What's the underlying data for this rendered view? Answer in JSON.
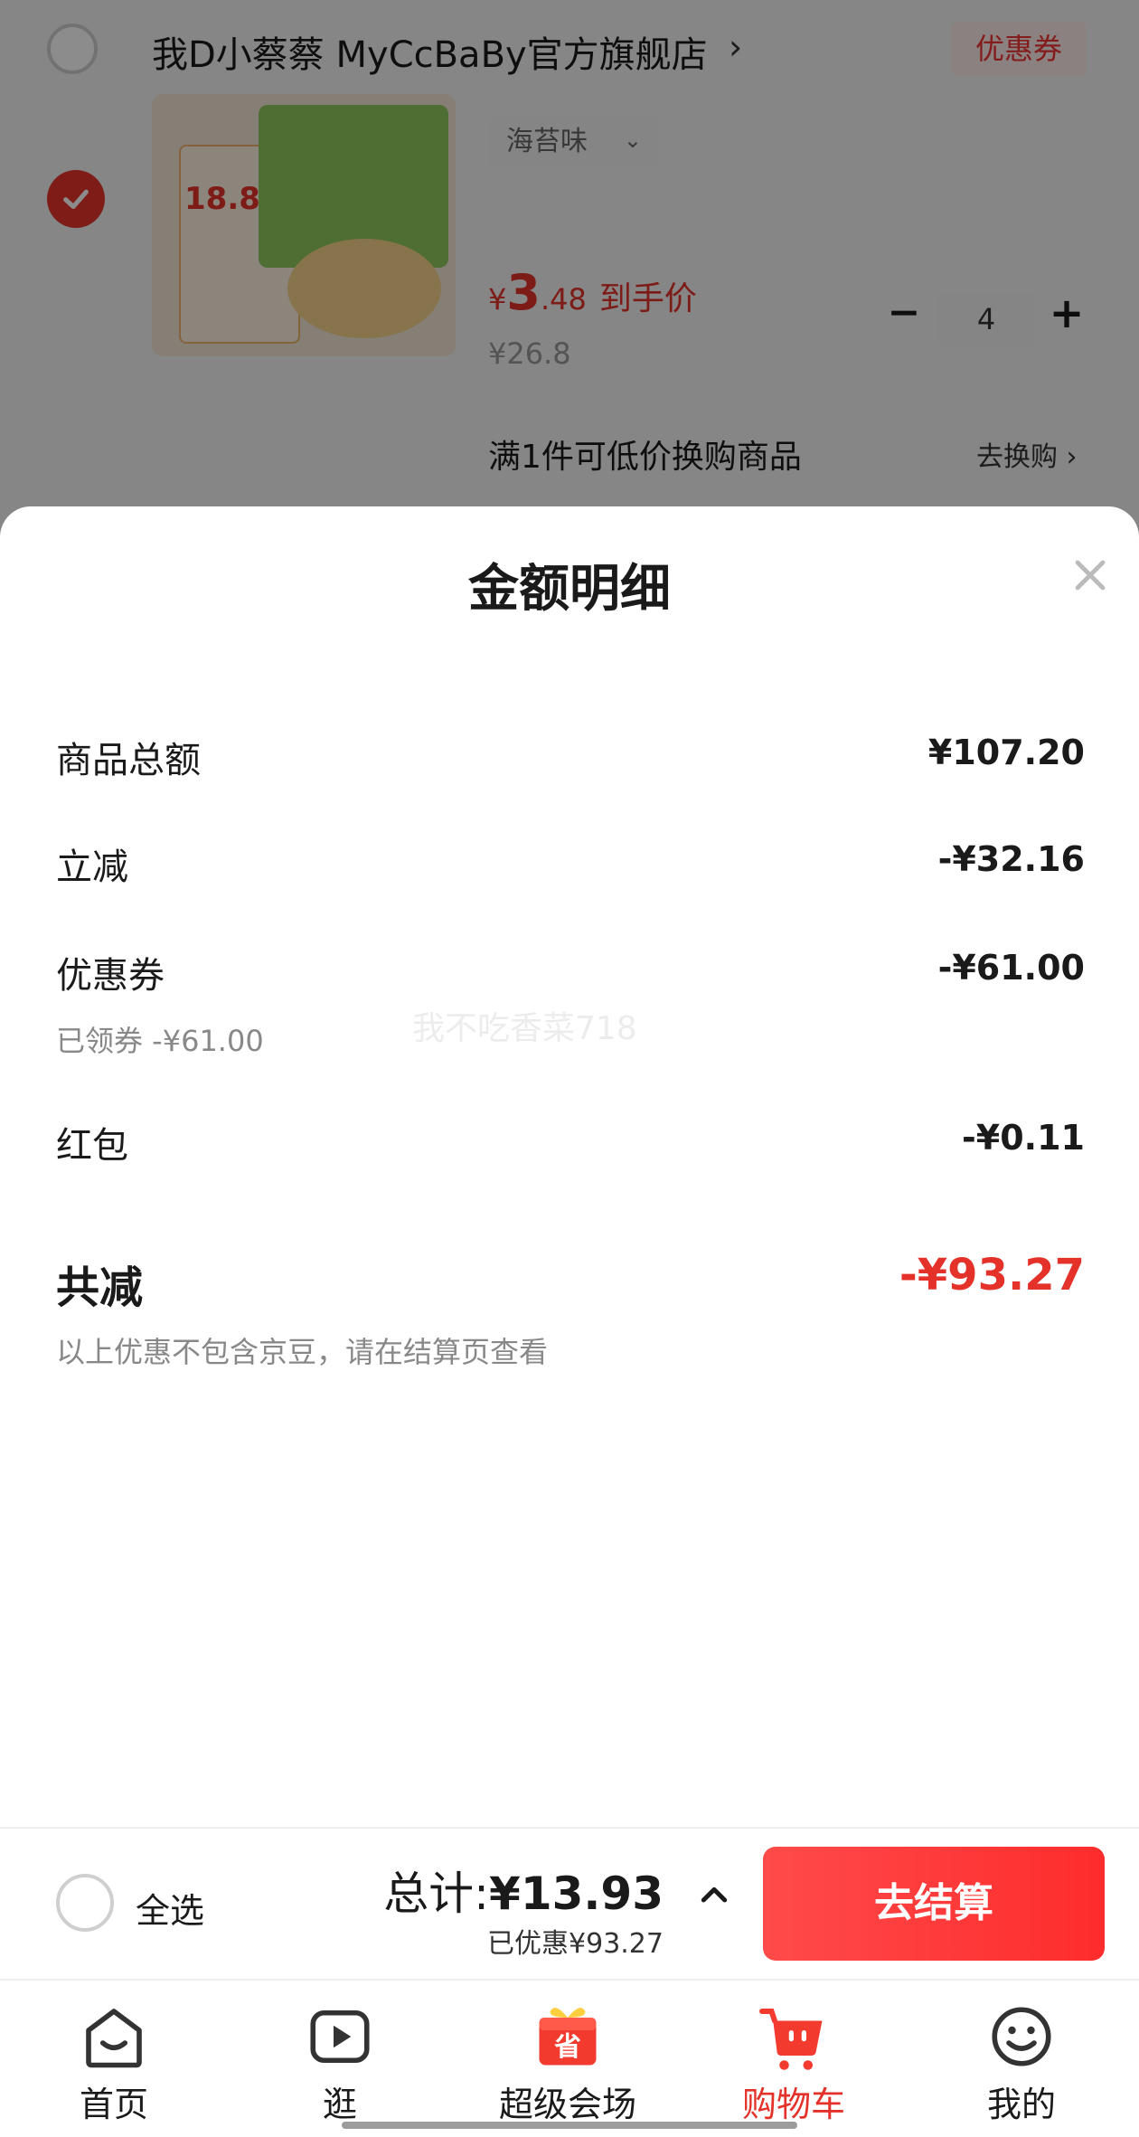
{
  "cart_item": {
    "store_name": "我D小蔡蔡 MyCcBaBy官方旗舰店",
    "store_chevron": "›",
    "coupon_tag": "优惠券",
    "spec": "海苔味",
    "spec_arrow": "⌄",
    "hand_price": {
      "symbol": "¥",
      "integer": "3",
      "decimal": ".48",
      "label": "到手价"
    },
    "original_price": "¥26.8",
    "quantity": "4",
    "qty_minus": "−",
    "qty_plus": "+",
    "exchange_text": "满1件可低价换购商品",
    "exchange_link": "去换购 ›",
    "image_price_badge": "18.8"
  },
  "sheet": {
    "title": "金额明细",
    "rows": [
      {
        "label": "商品总额",
        "value": "¥107.20"
      },
      {
        "label": "立减",
        "value": "-¥32.16"
      },
      {
        "label": "优惠券",
        "value": "-¥61.00",
        "sub": "已领券 -¥61.00"
      },
      {
        "label": "红包",
        "value": "-¥0.11"
      }
    ],
    "total_label": "共减",
    "total_value": "-¥93.27",
    "note": "以上优惠不包含京豆，请在结算页查看",
    "watermark": "我不吃香菜718"
  },
  "bottom_bar": {
    "select_all": "全选",
    "total_prefix": "总计:",
    "total_amount": "¥13.93",
    "saved": "已优惠¥93.27",
    "checkout": "去结算"
  },
  "tabs": [
    {
      "label": "首页",
      "icon": "home-icon"
    },
    {
      "label": "逛",
      "icon": "video-icon"
    },
    {
      "label": "超级会场",
      "icon": "gift-icon",
      "icon_text": "省"
    },
    {
      "label": "购物车",
      "icon": "cart-icon",
      "active": true
    },
    {
      "label": "我的",
      "icon": "smiley-icon"
    }
  ],
  "colors": {
    "accent": "#e4322a",
    "checkout": "#fe2c2c"
  }
}
